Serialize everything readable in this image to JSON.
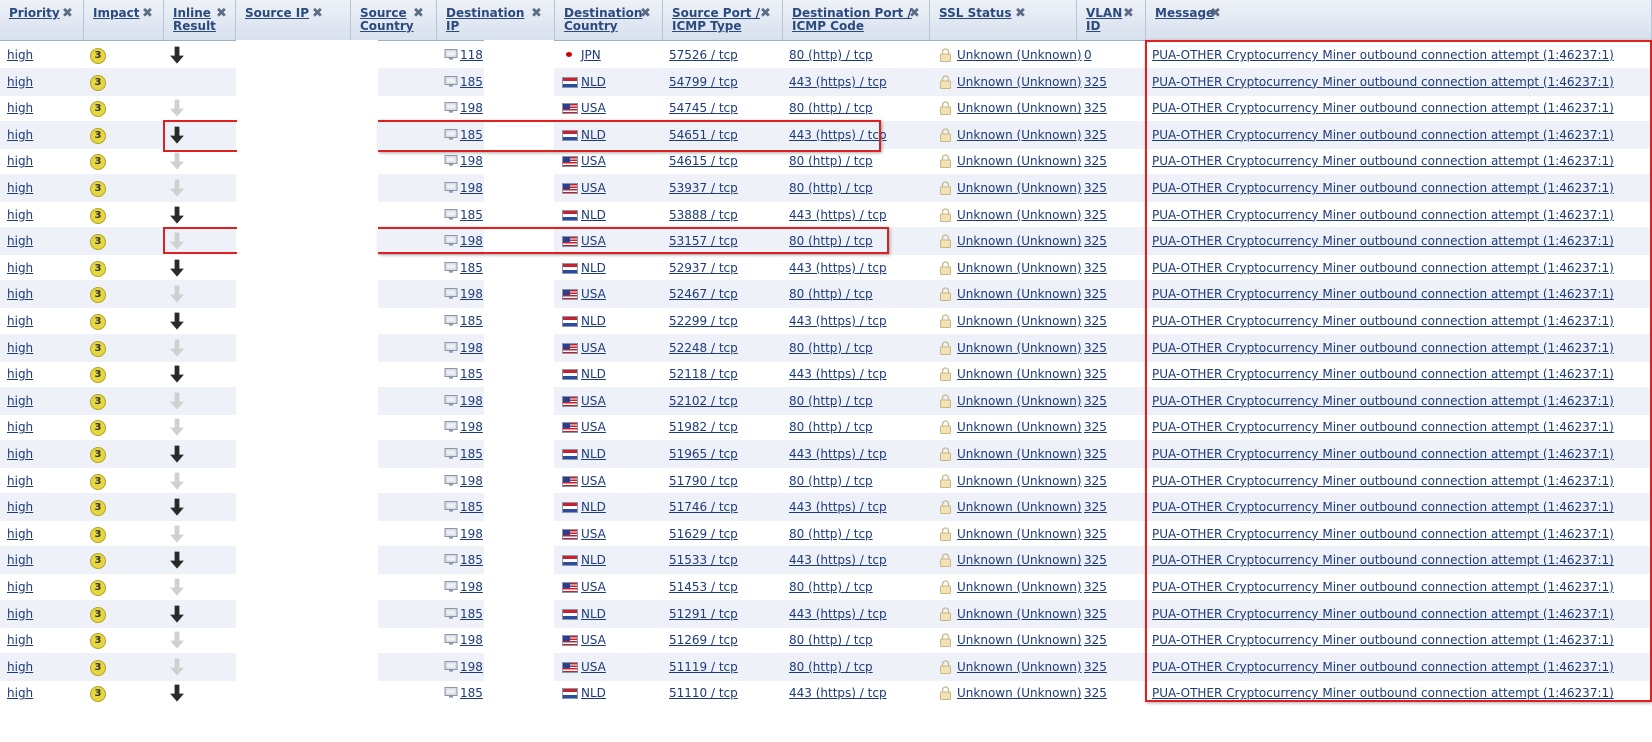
{
  "columns": [
    {
      "key": "priority",
      "label": "Priority"
    },
    {
      "key": "impact",
      "label": "Impact"
    },
    {
      "key": "inline",
      "label": "Inline\nResult"
    },
    {
      "key": "src_ip",
      "label": "Source IP"
    },
    {
      "key": "src_country",
      "label": "Source\nCountry"
    },
    {
      "key": "dst_ip",
      "label": "Destination\nIP"
    },
    {
      "key": "dst_country",
      "label": "Destination\nCountry"
    },
    {
      "key": "src_port",
      "label": "Source Port /\nICMP Type"
    },
    {
      "key": "dst_port",
      "label": "Destination Port /\nICMP Code"
    },
    {
      "key": "ssl",
      "label": "SSL Status"
    },
    {
      "key": "vlan",
      "label": "VLAN\nID"
    },
    {
      "key": "message",
      "label": "Message"
    }
  ],
  "close_glyph": "✖",
  "priority_value": "high",
  "impact_value": "3",
  "ssl_value": "Unknown (Unknown)",
  "message_value": "PUA-OTHER Cryptocurrency Miner outbound connection attempt (1:46237:1)",
  "colors": {
    "accent_red": "#e02020",
    "link": "#1d3b7c",
    "impact_badge": "#e6d640",
    "row_alt": "#eef1f7"
  },
  "rows": [
    {
      "inline": "dark",
      "dst_ip": "118",
      "flag": "jpn",
      "country": "JPN",
      "src_port": "57526 / tcp",
      "dst_port": "80 (http) / tcp",
      "vlan": "0"
    },
    {
      "inline": "none",
      "dst_ip": "185",
      "flag": "nld",
      "country": "NLD",
      "src_port": "54799 / tcp",
      "dst_port": "443 (https) / tcp",
      "vlan": "325"
    },
    {
      "inline": "light",
      "dst_ip": "198",
      "flag": "usa",
      "country": "USA",
      "src_port": "54745 / tcp",
      "dst_port": "80 (http) / tcp",
      "vlan": "325"
    },
    {
      "inline": "dark",
      "dst_ip": "185",
      "flag": "nld",
      "country": "NLD",
      "src_port": "54651 / tcp",
      "dst_port": "443 (https) / tcp",
      "vlan": "325"
    },
    {
      "inline": "light",
      "dst_ip": "198",
      "flag": "usa",
      "country": "USA",
      "src_port": "54615 / tcp",
      "dst_port": "80 (http) / tcp",
      "vlan": "325"
    },
    {
      "inline": "light",
      "dst_ip": "198",
      "flag": "usa",
      "country": "USA",
      "src_port": "53937 / tcp",
      "dst_port": "80 (http) / tcp",
      "vlan": "325"
    },
    {
      "inline": "dark",
      "dst_ip": "185",
      "flag": "nld",
      "country": "NLD",
      "src_port": "53888 / tcp",
      "dst_port": "443 (https) / tcp",
      "vlan": "325"
    },
    {
      "inline": "light",
      "dst_ip": "198",
      "flag": "usa",
      "country": "USA",
      "src_port": "53157 / tcp",
      "dst_port": "80 (http) / tcp",
      "vlan": "325"
    },
    {
      "inline": "dark",
      "dst_ip": "185",
      "flag": "nld",
      "country": "NLD",
      "src_port": "52937 / tcp",
      "dst_port": "443 (https) / tcp",
      "vlan": "325"
    },
    {
      "inline": "light",
      "dst_ip": "198",
      "flag": "usa",
      "country": "USA",
      "src_port": "52467 / tcp",
      "dst_port": "80 (http) / tcp",
      "vlan": "325"
    },
    {
      "inline": "dark",
      "dst_ip": "185",
      "flag": "nld",
      "country": "NLD",
      "src_port": "52299 / tcp",
      "dst_port": "443 (https) / tcp",
      "vlan": "325"
    },
    {
      "inline": "light",
      "dst_ip": "198",
      "flag": "usa",
      "country": "USA",
      "src_port": "52248 / tcp",
      "dst_port": "80 (http) / tcp",
      "vlan": "325"
    },
    {
      "inline": "dark",
      "dst_ip": "185",
      "flag": "nld",
      "country": "NLD",
      "src_port": "52118 / tcp",
      "dst_port": "443 (https) / tcp",
      "vlan": "325"
    },
    {
      "inline": "light",
      "dst_ip": "198",
      "flag": "usa",
      "country": "USA",
      "src_port": "52102 / tcp",
      "dst_port": "80 (http) / tcp",
      "vlan": "325"
    },
    {
      "inline": "light",
      "dst_ip": "198",
      "flag": "usa",
      "country": "USA",
      "src_port": "51982 / tcp",
      "dst_port": "80 (http) / tcp",
      "vlan": "325"
    },
    {
      "inline": "dark",
      "dst_ip": "185",
      "flag": "nld",
      "country": "NLD",
      "src_port": "51965 / tcp",
      "dst_port": "443 (https) / tcp",
      "vlan": "325"
    },
    {
      "inline": "light",
      "dst_ip": "198",
      "flag": "usa",
      "country": "USA",
      "src_port": "51790 / tcp",
      "dst_port": "80 (http) / tcp",
      "vlan": "325"
    },
    {
      "inline": "dark",
      "dst_ip": "185",
      "flag": "nld",
      "country": "NLD",
      "src_port": "51746 / tcp",
      "dst_port": "443 (https) / tcp",
      "vlan": "325"
    },
    {
      "inline": "light",
      "dst_ip": "198",
      "flag": "usa",
      "country": "USA",
      "src_port": "51629 / tcp",
      "dst_port": "80 (http) / tcp",
      "vlan": "325"
    },
    {
      "inline": "dark",
      "dst_ip": "185",
      "flag": "nld",
      "country": "NLD",
      "src_port": "51533 / tcp",
      "dst_port": "443 (https) / tcp",
      "vlan": "325"
    },
    {
      "inline": "light",
      "dst_ip": "198",
      "flag": "usa",
      "country": "USA",
      "src_port": "51453 / tcp",
      "dst_port": "80 (http) / tcp",
      "vlan": "325"
    },
    {
      "inline": "dark",
      "dst_ip": "185",
      "flag": "nld",
      "country": "NLD",
      "src_port": "51291 / tcp",
      "dst_port": "443 (https) / tcp",
      "vlan": "325"
    },
    {
      "inline": "light",
      "dst_ip": "198",
      "flag": "usa",
      "country": "USA",
      "src_port": "51269 / tcp",
      "dst_port": "80 (http) / tcp",
      "vlan": "325"
    },
    {
      "inline": "light",
      "dst_ip": "198",
      "flag": "usa",
      "country": "USA",
      "src_port": "51119 / tcp",
      "dst_port": "80 (http) / tcp",
      "vlan": "325"
    },
    {
      "inline": "dark",
      "dst_ip": "185",
      "flag": "nld",
      "country": "NLD",
      "src_port": "51110 / tcp",
      "dst_port": "443 (https) / tcp",
      "vlan": "325"
    }
  ]
}
